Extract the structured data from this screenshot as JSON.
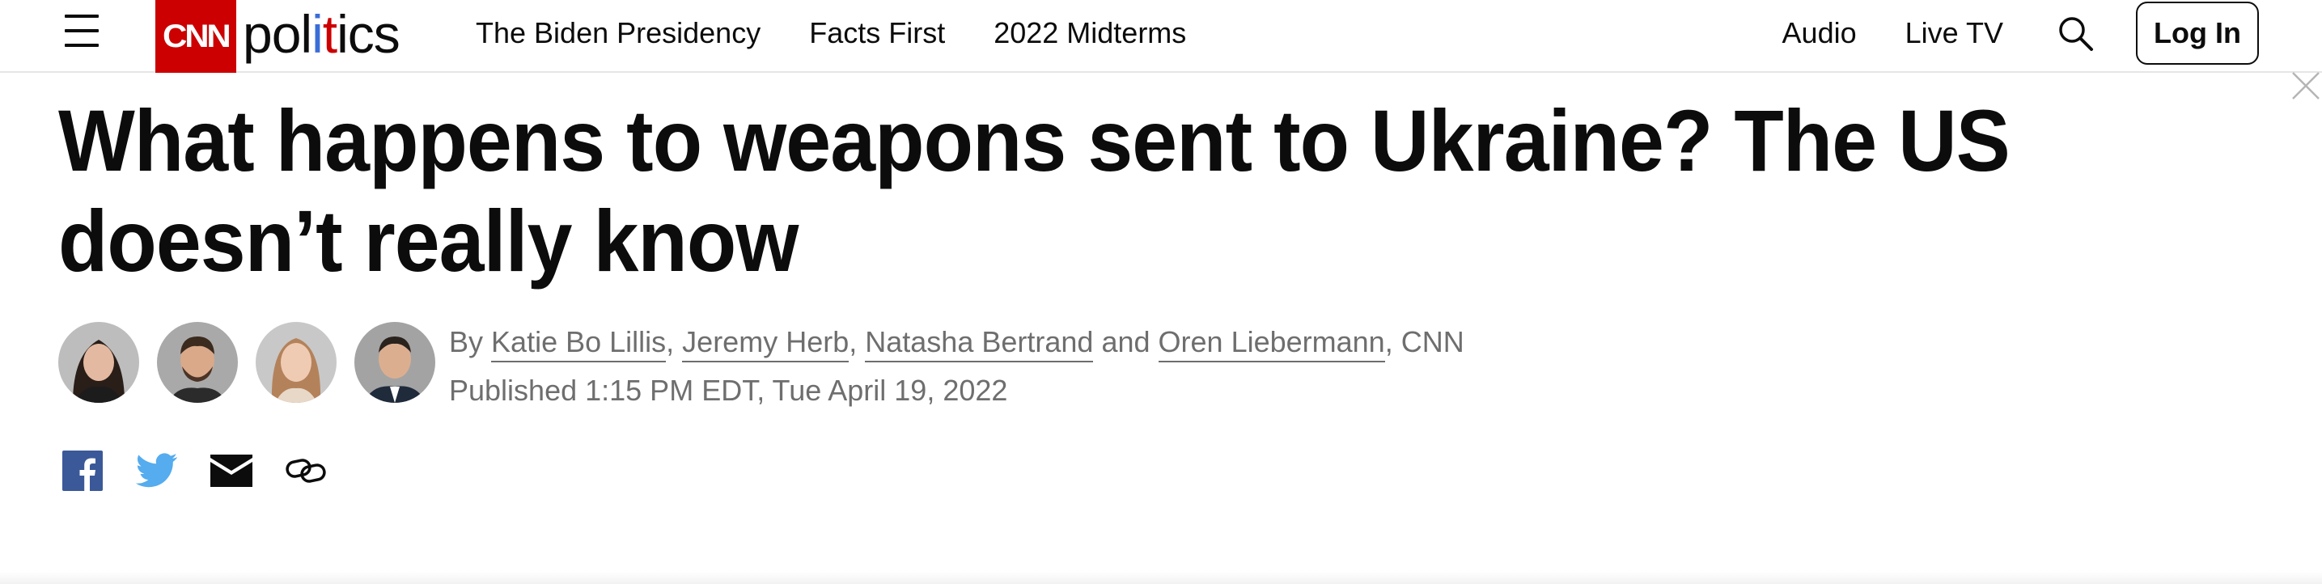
{
  "header": {
    "logo": {
      "brand": "CNN",
      "section": "politics"
    },
    "nav_items": [
      {
        "label": "The Biden Presidency"
      },
      {
        "label": "Facts First"
      },
      {
        "label": "2022 Midterms"
      }
    ],
    "right_items": [
      {
        "label": "Audio"
      },
      {
        "label": "Live TV"
      }
    ],
    "search_icon": "search-icon",
    "login_label": "Log In"
  },
  "article": {
    "headline": "What happens to weapons sent to Ukraine? The US doesn’t really know",
    "byline": {
      "prefix": "By",
      "authors": [
        "Katie Bo Lillis",
        "Jeremy Herb",
        "Natasha Bertrand",
        "Oren Liebermann"
      ],
      "separator": ",",
      "conjunction": "and",
      "outlet": ", CNN"
    },
    "published": "Published 1:15 PM EDT, Tue April 19, 2022",
    "share_icons": [
      "facebook-icon",
      "twitter-icon",
      "email-icon",
      "link-icon"
    ]
  },
  "colors": {
    "cnn_red": "#cc0000",
    "politics_blue": "#3b6dd8",
    "facebook_blue": "#3b5998",
    "twitter_blue": "#55acee",
    "meta_gray": "#6e6e6e"
  }
}
